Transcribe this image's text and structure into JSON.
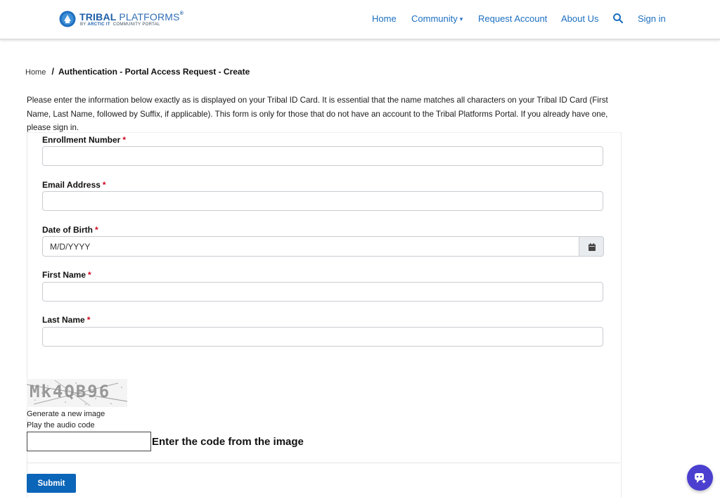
{
  "header": {
    "logo_word1": "TRIBAL",
    "logo_word2": "PLATFORMS",
    "logo_tm": "®",
    "logo_by": "BY",
    "logo_brand": "ARCTIC IT",
    "logo_portal": "COMMUNITY PORTAL",
    "nav": {
      "home": "Home",
      "community": "Community",
      "request_account": "Request Account",
      "about_us": "About Us",
      "sign_in": "Sign in"
    },
    "link_color": "#1c6fc0"
  },
  "breadcrumb": {
    "home": "Home",
    "separator": "/",
    "current": "Authentication - Portal Access Request - Create"
  },
  "intro_text": "Please enter the information below exactly as is displayed on your Tribal ID Card. It is essential that the name matches all characters on your Tribal ID Card (First Name, Last Name, followed by Suffix, if applicable). This form is only for those that do not have an account to the Tribal Platforms Portal. If you already have one, please sign in.",
  "form": {
    "required_marker": "*",
    "enrollment_number": {
      "label": "Enrollment Number",
      "value": ""
    },
    "email_address": {
      "label": "Email Address",
      "value": ""
    },
    "date_of_birth": {
      "label": "Date of Birth",
      "placeholder": "M/D/YYYY",
      "value": ""
    },
    "first_name": {
      "label": "First Name",
      "value": ""
    },
    "last_name": {
      "label": "Last Name",
      "value": ""
    },
    "captcha": {
      "image_text": "Mk4QB96",
      "generate_new": "Generate a new image",
      "play_audio": "Play the audio code",
      "prompt": "Enter the code from the image",
      "value": ""
    },
    "submit_label": "Submit"
  },
  "colors": {
    "primary": "#0b65b8",
    "required": "#d0021b",
    "chat_fab": "#4a3fcf"
  },
  "icons": {
    "logo": "tribal-platforms-logo",
    "search": "search-icon",
    "calendar": "calendar-icon",
    "chat": "chat-assistant-icon"
  }
}
